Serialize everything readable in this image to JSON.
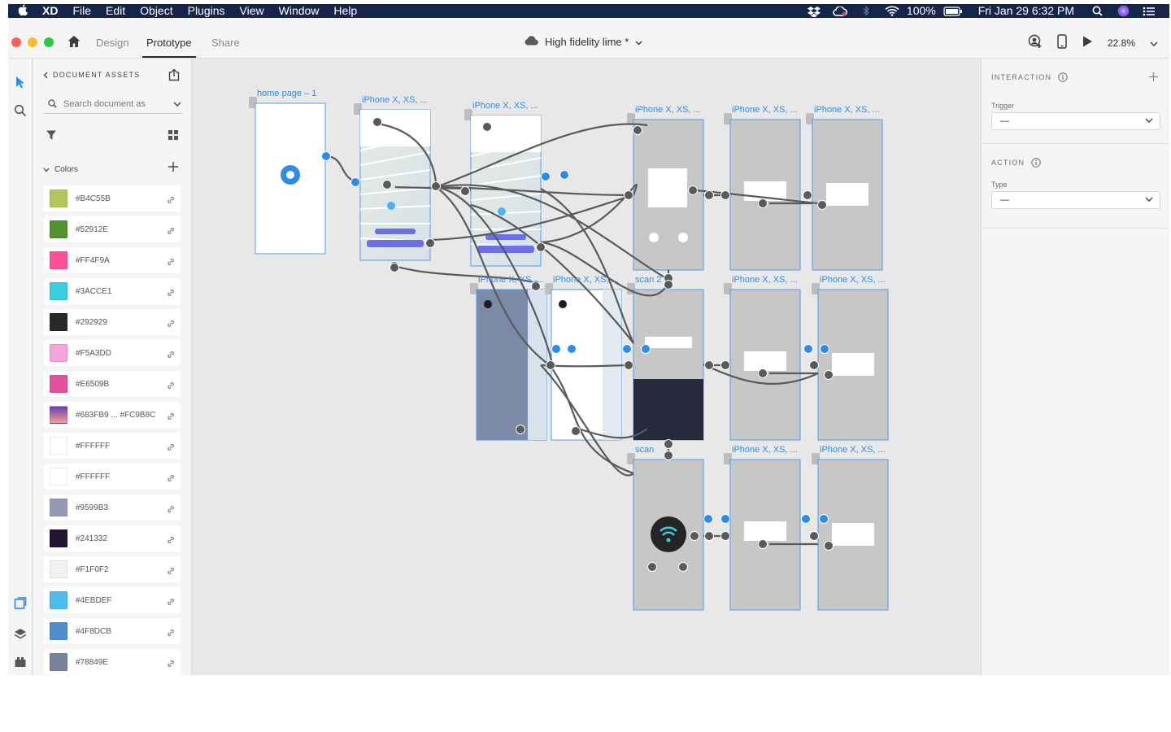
{
  "menubar": {
    "app": "XD",
    "items": [
      "File",
      "Edit",
      "Object",
      "Plugins",
      "View",
      "Window",
      "Help"
    ],
    "battery": "100%",
    "clock": "Fri Jan 29  6:32 PM"
  },
  "titlebar": {
    "tabs": [
      "Design",
      "Prototype",
      "Share"
    ],
    "active_tab": "Prototype",
    "document_title": "High fidelity lime *",
    "zoom": "22.8%"
  },
  "assets": {
    "header": "DOCUMENT ASSETS",
    "search_placeholder": "Search document as",
    "colors_label": "Colors",
    "colors": [
      {
        "label": "#B4C55B",
        "hex": "#B4C55B"
      },
      {
        "label": "#52912E",
        "hex": "#52912E"
      },
      {
        "label": "#FF4F9A",
        "hex": "#FF4F9A"
      },
      {
        "label": "#3ACCE1",
        "hex": "#3ACCE1"
      },
      {
        "label": "#292929",
        "hex": "#292929"
      },
      {
        "label": "#F5A3DD",
        "hex": "#F5A3DD"
      },
      {
        "label": "#E6509B",
        "hex": "#E6509B"
      },
      {
        "label": "#683FB9 ... #FC9B8C",
        "hex": "linear-gradient(#683FB9,#FC9B8C)"
      },
      {
        "label": "#FFFFFF",
        "hex": "#FFFFFF"
      },
      {
        "label": "#FFFFFF",
        "hex": "#FFFFFF"
      },
      {
        "label": "#9599B3",
        "hex": "#9599B3"
      },
      {
        "label": "#241332",
        "hex": "#241332"
      },
      {
        "label": "#F1F0F2",
        "hex": "#F1F0F2"
      },
      {
        "label": "#4EBDEF",
        "hex": "#4EBDEF"
      },
      {
        "label": "#4F8DCB",
        "hex": "#4F8DCB"
      },
      {
        "label": "#78849E",
        "hex": "#78849E"
      }
    ]
  },
  "artboards": {
    "home": "home page – 1",
    "map1": "iPhone X, XS, ...",
    "map2": "iPhone X, XS, ...",
    "r1c1": "iPhone X, XS, ...",
    "r1c2": "iPhone X, XS, ...",
    "r1c3": "iPhone X, XS, ...",
    "menu1": "iPhone X, XS, ...",
    "menu2": "iPhone X, XS, ...",
    "scan2": "scan 2",
    "r2c2": "iPhone X, XS, ...",
    "r2c3": "iPhone X, XS, ...",
    "scan": "scan",
    "r3c2": "iPhone X, XS, ...",
    "r3c3": "iPhone X, XS, ..."
  },
  "interaction": {
    "title": "INTERACTION",
    "trigger_label": "Trigger",
    "trigger_value": "—",
    "action_title": "ACTION",
    "type_label": "Type",
    "type_value": "—"
  },
  "colors": {
    "accent": "#2D8CEB",
    "wire": "#5A5A5A",
    "wire_active": "#2D8CEB"
  }
}
